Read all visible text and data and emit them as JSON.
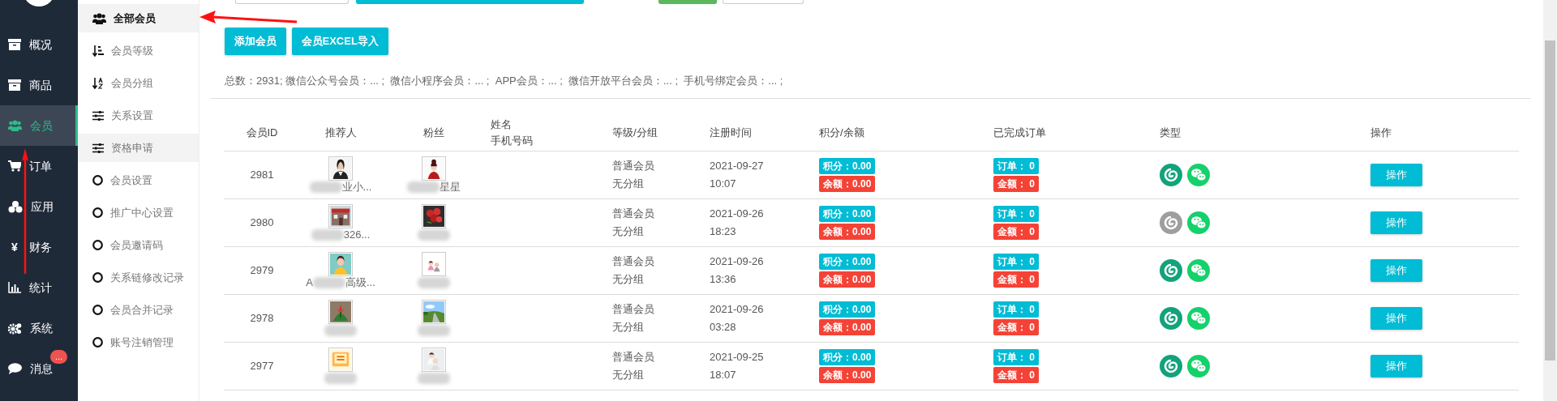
{
  "nav": [
    {
      "label": "概况",
      "kind": "box",
      "selected": false
    },
    {
      "label": "商品",
      "kind": "box",
      "selected": false
    },
    {
      "label": "会员",
      "kind": "users",
      "selected": true
    },
    {
      "label": "订单",
      "kind": "cart",
      "selected": false
    },
    {
      "label": "应用",
      "kind": "cubes",
      "selected": false
    },
    {
      "label": "财务",
      "kind": "glyph",
      "glyph": "¥",
      "selected": false
    },
    {
      "label": "统计",
      "kind": "chart",
      "selected": false
    },
    {
      "label": "系统",
      "kind": "gears",
      "selected": false
    },
    {
      "label": "消息",
      "kind": "chat",
      "selected": false,
      "badge": "..."
    }
  ],
  "subnav": [
    {
      "label": "全部会员",
      "kind": "users",
      "selected": true,
      "hovered": false
    },
    {
      "label": "会员等级",
      "kind": "sort-level",
      "selected": false,
      "hovered": false
    },
    {
      "label": "会员分组",
      "kind": "sort-az",
      "selected": false,
      "hovered": false
    },
    {
      "label": "关系设置",
      "kind": "sliders",
      "selected": false,
      "hovered": false
    },
    {
      "label": "资格申请",
      "kind": "sliders",
      "selected": false,
      "hovered": true
    },
    {
      "label": "会员设置",
      "kind": "circle",
      "selected": false,
      "hovered": false
    },
    {
      "label": "推广中心设置",
      "kind": "circle",
      "selected": false,
      "hovered": false
    },
    {
      "label": "会员邀请码",
      "kind": "circle",
      "selected": false,
      "hovered": false
    },
    {
      "label": "关系链修改记录",
      "kind": "circle",
      "selected": false,
      "hovered": false
    },
    {
      "label": "会员合并记录",
      "kind": "circle",
      "selected": false,
      "hovered": false
    },
    {
      "label": "账号注销管理",
      "kind": "circle",
      "selected": false,
      "hovered": false
    }
  ],
  "actions": [
    "添加会员",
    "会员EXCEL导入"
  ],
  "summary": "总数：2931; 微信公众号会员：... ;  微信小程序会员：... ;  APP会员：... ;  微信开放平台会员：... ;  手机号绑定会员：... ;",
  "table": {
    "columns": [
      "会员ID",
      "推荐人",
      "粉丝",
      [
        "姓名",
        "手机号码"
      ],
      "等级/分组",
      "注册时间",
      "积分/余额",
      "已完成订单",
      "类型",
      "操作"
    ],
    "rows": [
      {
        "id": "2981",
        "referrer": {
          "name_fragments": [
            "业小..."
          ]
        },
        "fan": {
          "name_fragments": [
            "星星"
          ]
        },
        "level": "普通会员",
        "group": "无分组",
        "date": "2021-09-27",
        "time": "10:07",
        "points": "积分：0.00",
        "balance": "余额：0.00",
        "orders": "订单： 0",
        "amount": "金额： 0",
        "types": [
          {
            "kind": "app",
            "on": true
          },
          {
            "kind": "wechat",
            "on": true
          }
        ],
        "action": "操作"
      },
      {
        "id": "2980",
        "referrer": {
          "name_fragments": [
            "326..."
          ]
        },
        "fan": {},
        "level": "普通会员",
        "group": "无分组",
        "date": "2021-09-26",
        "time": "18:23",
        "points": "积分：0.00",
        "balance": "余额：0.00",
        "orders": "订单： 0",
        "amount": "金额： 0",
        "types": [
          {
            "kind": "app",
            "on": false
          },
          {
            "kind": "wechat",
            "on": true
          }
        ],
        "action": "操作"
      },
      {
        "id": "2979",
        "referrer": {
          "name_fragments": [
            "A",
            "高级..."
          ]
        },
        "fan": {},
        "level": "普通会员",
        "group": "无分组",
        "date": "2021-09-26",
        "time": "13:36",
        "points": "积分：0.00",
        "balance": "余额：0.00",
        "orders": "订单： 0",
        "amount": "金额： 0",
        "types": [
          {
            "kind": "app",
            "on": true
          },
          {
            "kind": "wechat",
            "on": true
          }
        ],
        "action": "操作"
      },
      {
        "id": "2978",
        "referrer": {},
        "fan": {},
        "level": "普通会员",
        "group": "无分组",
        "date": "2021-09-26",
        "time": "03:28",
        "points": "积分：0.00",
        "balance": "余额：0.00",
        "orders": "订单： 0",
        "amount": "金额： 0",
        "types": [
          {
            "kind": "app",
            "on": true
          },
          {
            "kind": "wechat",
            "on": true
          }
        ],
        "action": "操作"
      },
      {
        "id": "2977",
        "referrer": {},
        "fan": {},
        "level": "普通会员",
        "group": "无分组",
        "date": "2021-09-25",
        "time": "18:07",
        "points": "积分：0.00",
        "balance": "余额：0.00",
        "orders": "订单： 0",
        "amount": "金额： 0",
        "types": [
          {
            "kind": "app",
            "on": true
          },
          {
            "kind": "wechat",
            "on": true
          }
        ],
        "action": "操作"
      }
    ]
  }
}
